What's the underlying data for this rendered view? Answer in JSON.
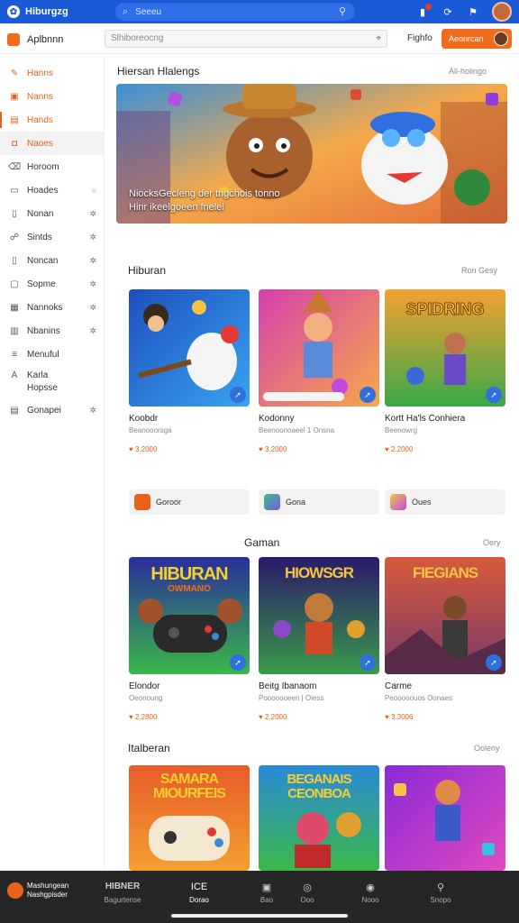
{
  "topbar": {
    "brand": "Hiburgzg",
    "search_placeholder": "Seeeu",
    "icons": [
      "app-logo-icon",
      "search-icon",
      "mic-icon",
      "notification-icon",
      "refresh-icon",
      "flag-icon"
    ]
  },
  "appbar": {
    "app_name": "Aplbnnn",
    "search_placeholder": "Slhiboreocng",
    "link": "Fighfo",
    "button_label": "Aeonrcan"
  },
  "sidebar": {
    "items": [
      {
        "label": "Hanns",
        "icon": "gamepad-icon"
      },
      {
        "label": "Nanns",
        "icon": "grid-icon"
      },
      {
        "label": "Hands",
        "icon": "bookmark-icon"
      },
      {
        "label": "Naoes",
        "icon": "chat-icon"
      },
      {
        "label": "Horoom",
        "icon": "tag-icon"
      },
      {
        "label": "Hoades",
        "icon": "list-icon"
      },
      {
        "label": "Nonan",
        "icon": "doc-icon"
      },
      {
        "label": "Sintds",
        "icon": "people-icon"
      },
      {
        "label": "Noncan",
        "icon": "page-icon"
      },
      {
        "label": "Sopme",
        "icon": "box-icon"
      },
      {
        "label": "Nannoks",
        "icon": "calendar-icon"
      },
      {
        "label": "Nbanins",
        "icon": "chart-icon"
      },
      {
        "label": "Menuful",
        "icon": "menu-icon"
      },
      {
        "label": "Karla\nHopsse",
        "icon": "font-icon"
      },
      {
        "label": "Gonapei",
        "icon": "file-icon"
      }
    ]
  },
  "hero": {
    "section_title": "Hiersan Hlalengs",
    "see_more": "All-holingo",
    "text": "NiocksGecleng der tngchois tonno Hinr ikeelgoeen fnelel"
  },
  "section1": {
    "title": "Hiburan",
    "see_more": "Ron Gesy",
    "cards": [
      {
        "title": "Koobdr",
        "sub": "Beanooorsga",
        "price": "3.2000"
      },
      {
        "title": "Kodonny",
        "sub": "Beenoonoaeel 1 Onsna",
        "price": "3.2000"
      },
      {
        "title": "Kortt Ha'ls Conhiera",
        "sub": "Beenowrg",
        "price": "2.2000"
      }
    ]
  },
  "chips": [
    {
      "label": "Goroor"
    },
    {
      "label": "Gona"
    },
    {
      "label": "Oues"
    }
  ],
  "section2": {
    "title": "Gaman",
    "see_more": "Oery",
    "cards": [
      {
        "title": "Elondor",
        "sub": "Oeonoung",
        "price": "2.2800",
        "art": "HIBURAN",
        "art_sub": "OWMANO"
      },
      {
        "title": "Beitg Ibanaom",
        "sub": "Pooooooeen | Oiess",
        "price": "2.2000",
        "art": "HIOWSGR"
      },
      {
        "title": "Carme",
        "sub": "Peooooouos Oonaes",
        "price": "3.3006",
        "art": "FIEGIANS"
      }
    ]
  },
  "section3": {
    "title": "Italberan",
    "see_more": "Ooleny",
    "cards": [
      {
        "art": "SAMARA MIOURFEIS"
      },
      {
        "art": "BEGANAIS CEONBOA"
      },
      {
        "art": ""
      }
    ]
  },
  "bottombar": {
    "brand_line1": "Mashungean",
    "brand_line2": "Nashgpisder",
    "title_line1": "HIBNER",
    "title_line2": "Bagurtense",
    "items": [
      {
        "label": "Dorao",
        "icon": "home-icon",
        "glyph": "ICE"
      },
      {
        "label": "Bao",
        "icon": "video-icon",
        "glyph": "▣"
      },
      {
        "label": "Ooo",
        "icon": "search-icon",
        "glyph": "◎"
      },
      {
        "label": "Nooo",
        "icon": "circle-icon",
        "glyph": "◉"
      },
      {
        "label": "Snopo",
        "icon": "profile-icon",
        "glyph": "⚲"
      }
    ]
  },
  "colors": {
    "primary": "#1b5ad6",
    "accent": "#f06b1c",
    "bottom": "#262626"
  }
}
